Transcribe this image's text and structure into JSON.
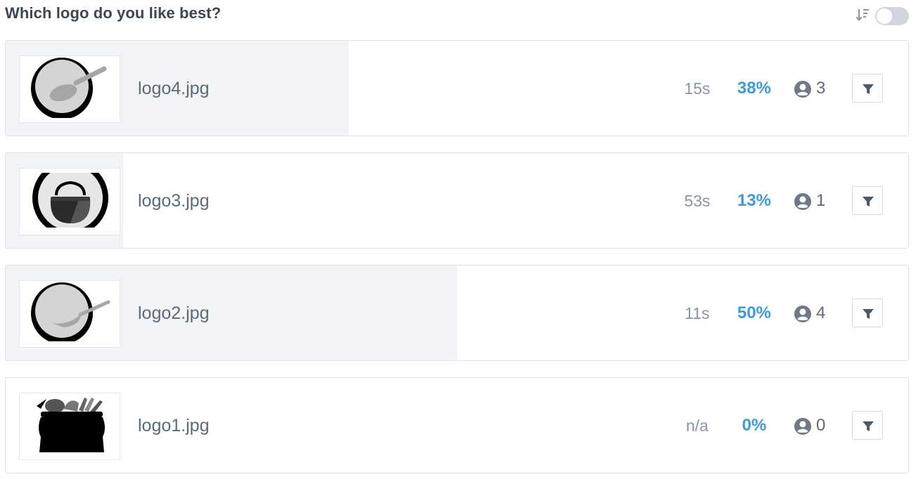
{
  "question": "Which logo do you like best?",
  "controls": {
    "sort_icon": "sort-descending-icon",
    "toggle_on": false
  },
  "colors": {
    "percent": "#3b9be0",
    "bar": "#f1f3f6"
  },
  "results": [
    {
      "file": "logo4.jpg",
      "time": "15s",
      "percent": "38%",
      "share": 0.38,
      "voters": "3",
      "thumbnail": "bowl-with-spoon"
    },
    {
      "file": "logo3.jpg",
      "time": "53s",
      "percent": "13%",
      "share": 0.13,
      "voters": "1",
      "thumbnail": "cauldron-in-circle"
    },
    {
      "file": "logo2.jpg",
      "time": "11s",
      "percent": "50%",
      "share": 0.5,
      "voters": "4",
      "thumbnail": "bowl-with-spoon"
    },
    {
      "file": "logo1.jpg",
      "time": "n/a",
      "percent": "0%",
      "share": 0.0,
      "voters": "0",
      "thumbnail": "pot-silhouette"
    }
  ]
}
